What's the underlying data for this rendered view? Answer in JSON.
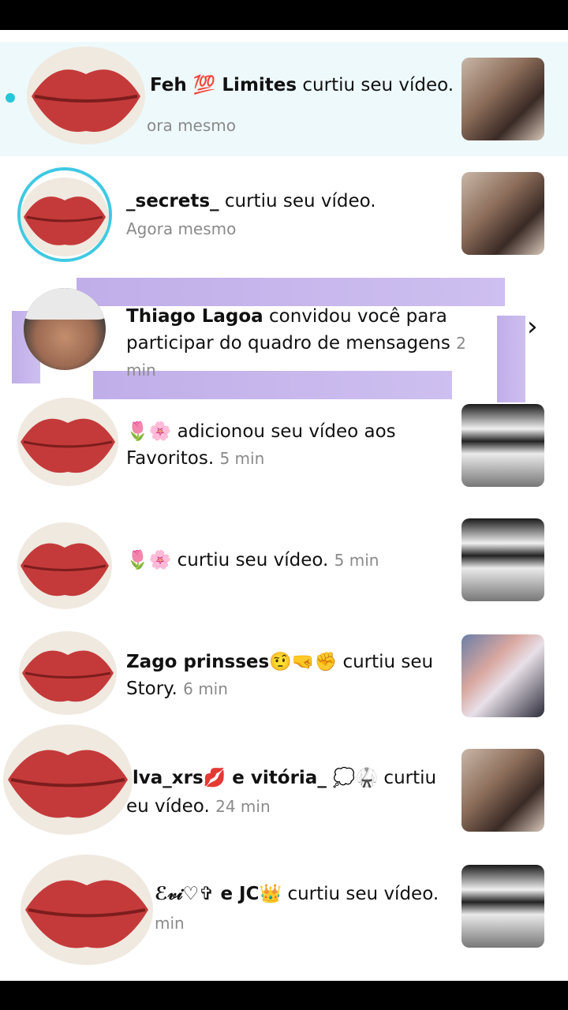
{
  "notifications": [
    {
      "name": "Feh 💯 Limites",
      "action": "curtiu seu vídeo.",
      "time_line": "ora mesmo",
      "unread": true
    },
    {
      "name": "_secrets_",
      "action": "curtiu seu vídeo.",
      "time_line": "Agora mesmo"
    },
    {
      "name": "Thiago Lagoa",
      "action": "convidou você para participar do quadro de mensagens",
      "time": "2 min"
    },
    {
      "name": "🌷🌸",
      "action": "adicionou seu vídeo aos Favoritos.",
      "time": "5 min"
    },
    {
      "name": "🌷🌸",
      "action": "curtiu seu vídeo.",
      "time": "5 min"
    },
    {
      "name": "Zago prinsses🤨🤜✊",
      "action": "curtiu seu Story.",
      "time": "6 min"
    },
    {
      "name": "ilva_xrs💋 e vitória_ 💭🥋",
      "action": "curtiu",
      "line2": "eu vídeo.",
      "time": "24 min"
    },
    {
      "name": "ℰ𝓋𝒾♡✞ e JC👑",
      "action": "curtiu seu vídeo.",
      "time_line": "min"
    }
  ],
  "icons": {
    "chevron": "chevron-right-icon",
    "lips": "lips-sticker-icon"
  },
  "colors": {
    "unread_bg": "#eef9fb",
    "unread_dot": "#25c7d6",
    "purple_overlay": "#b9a5e6"
  }
}
